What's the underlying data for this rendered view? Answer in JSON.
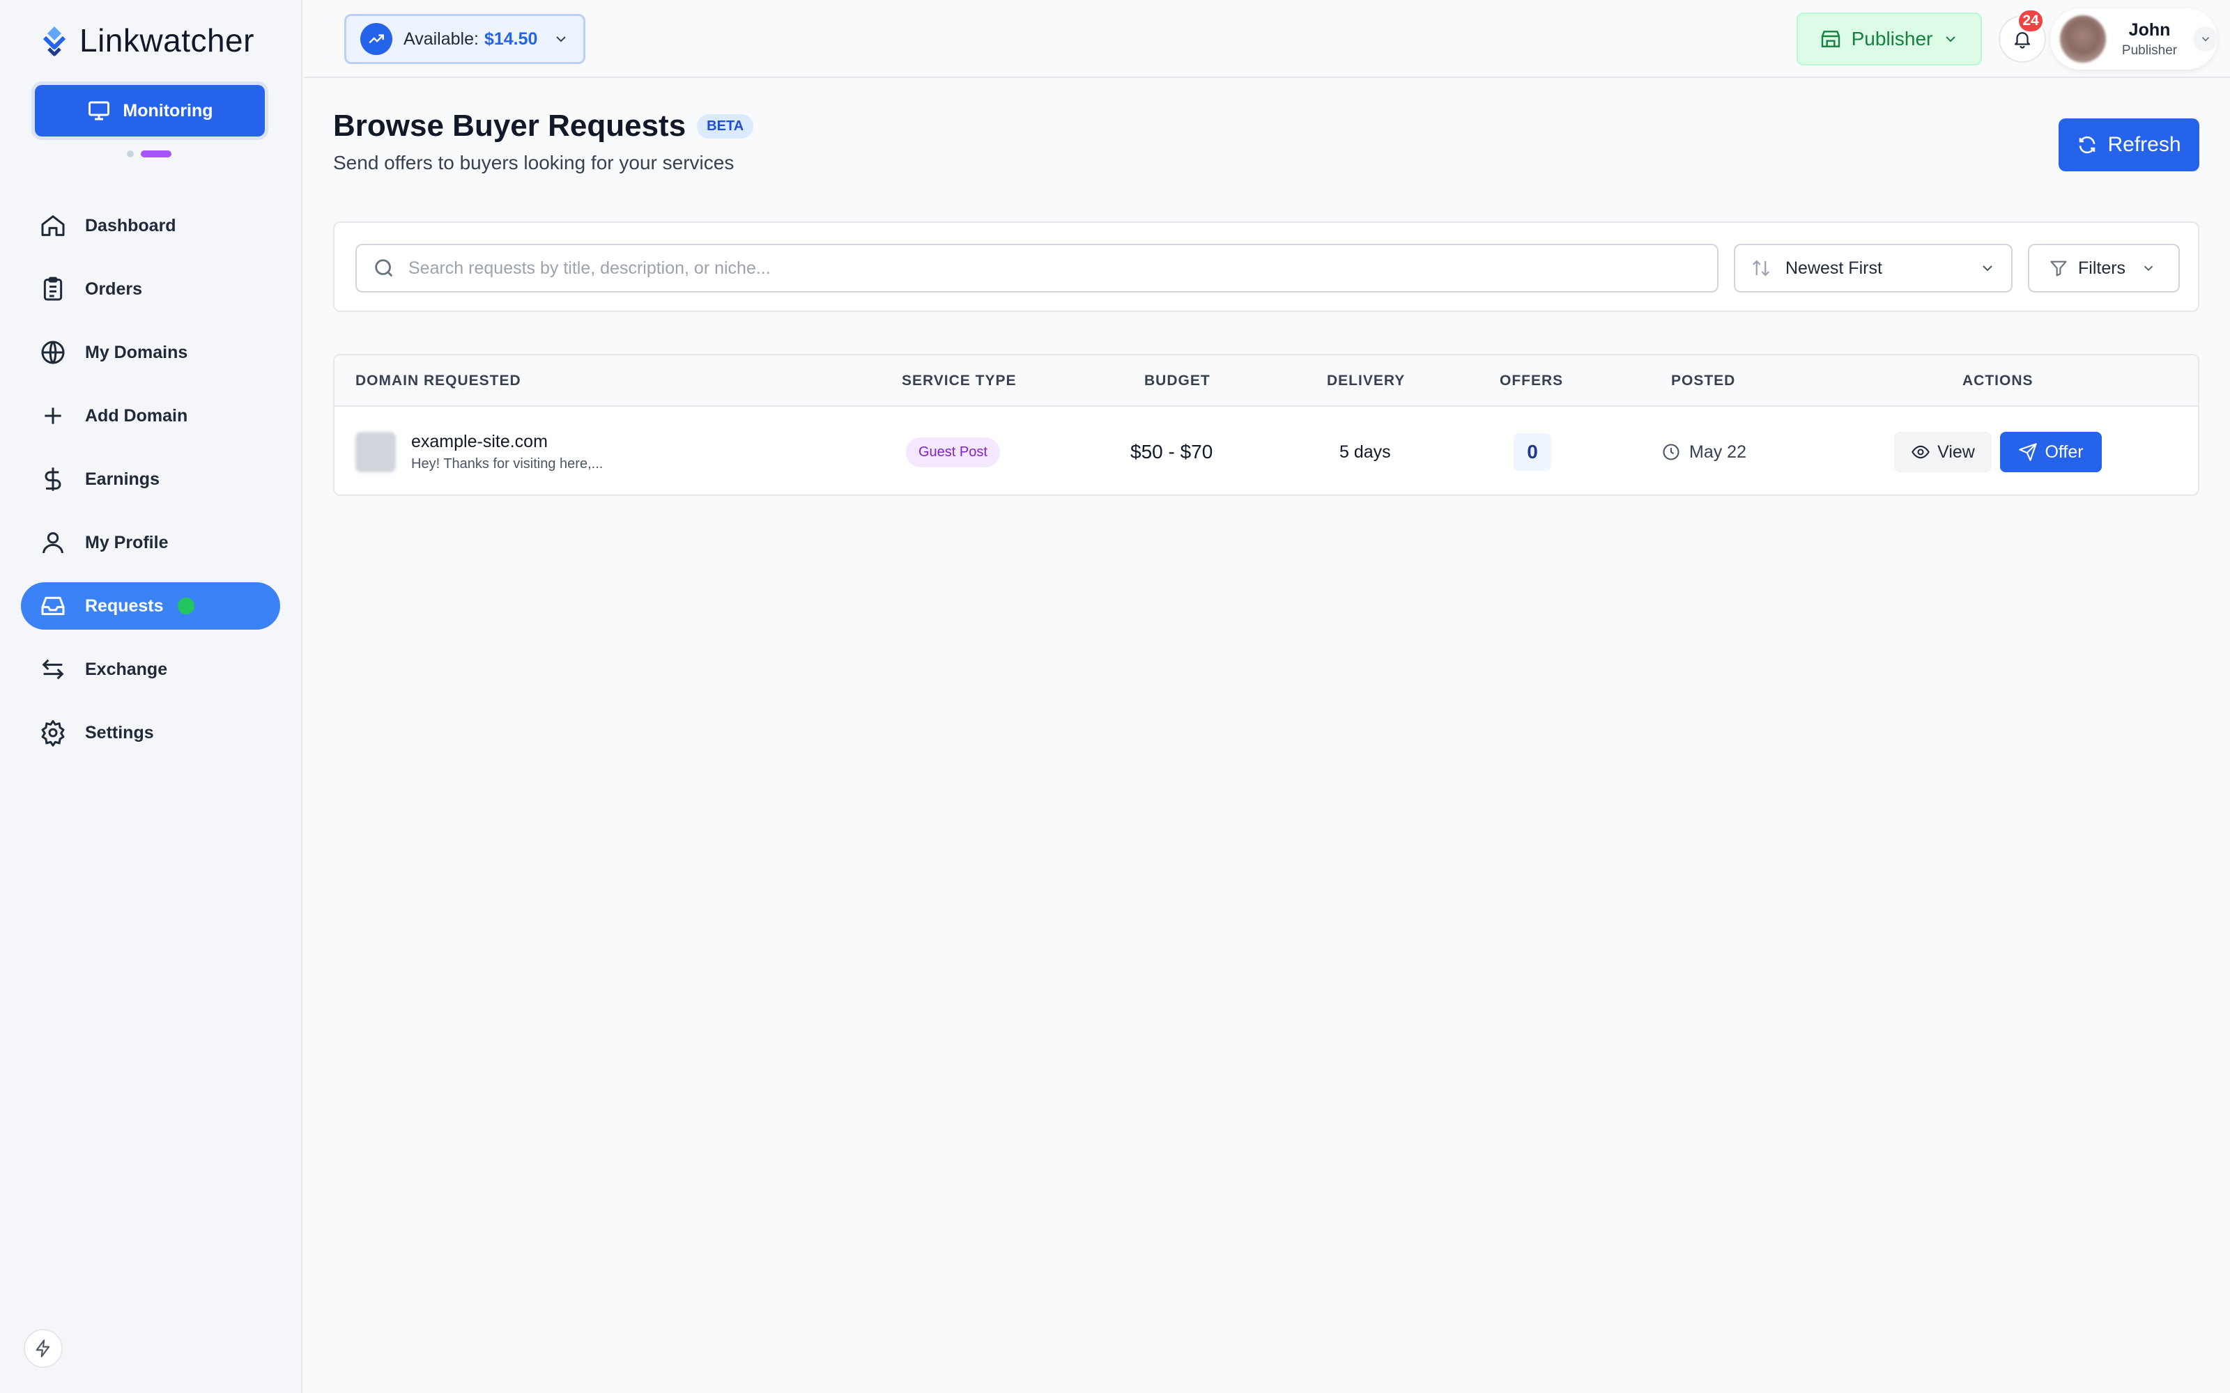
{
  "app": {
    "name": "Linkwatcher"
  },
  "sidebar": {
    "monitoring_label": "Monitoring",
    "items": [
      {
        "label": "Dashboard",
        "icon": "home-icon"
      },
      {
        "label": "Orders",
        "icon": "clipboard-icon"
      },
      {
        "label": "My Domains",
        "icon": "globe-icon"
      },
      {
        "label": "Add Domain",
        "icon": "plus-icon"
      },
      {
        "label": "Earnings",
        "icon": "dollar-icon"
      },
      {
        "label": "My Profile",
        "icon": "user-icon"
      },
      {
        "label": "Requests",
        "icon": "inbox-icon",
        "active": true,
        "status_dot": "#22c55e"
      },
      {
        "label": "Exchange",
        "icon": "arrows-icon"
      },
      {
        "label": "Settings",
        "icon": "gear-icon"
      }
    ]
  },
  "topbar": {
    "balance_label": "Available:",
    "balance_amount": "$14.50",
    "role_button": "Publisher",
    "notifications_count": "24",
    "user_name": "John",
    "user_role": "Publisher"
  },
  "page": {
    "title": "Browse Buyer Requests",
    "badge": "BETA",
    "subtitle": "Send offers to buyers looking for your services",
    "refresh_label": "Refresh"
  },
  "filters": {
    "search_placeholder": "Search requests by title, description, or niche...",
    "sort_value": "Newest First",
    "filters_label": "Filters"
  },
  "table": {
    "headers": [
      "DOMAIN REQUESTED",
      "SERVICE TYPE",
      "BUDGET",
      "DELIVERY",
      "OFFERS",
      "POSTED",
      "ACTIONS"
    ],
    "rows": [
      {
        "domain": "example-site.com",
        "description": "Hey! Thanks for visiting here,...",
        "service_type": "Guest Post",
        "budget": "$50 - $70",
        "delivery": "5 days",
        "offers": "0",
        "posted": "May 22",
        "view_label": "View",
        "offer_label": "Offer"
      }
    ]
  },
  "colors": {
    "accent": "#2563eb",
    "active_nav": "#3b82f6",
    "publisher_bg": "#dcfce7",
    "badge_red": "#ef4444",
    "service_badge": "#7e22ce"
  }
}
